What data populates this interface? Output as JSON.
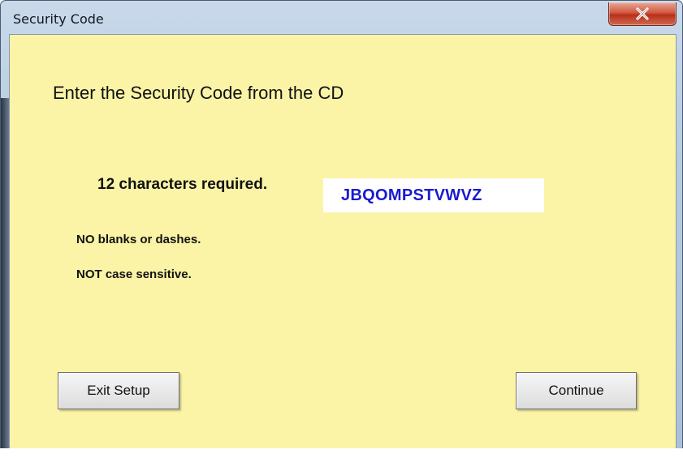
{
  "window": {
    "title": "Security Code",
    "close_icon": "close-icon"
  },
  "dialog": {
    "heading": "Enter the Security Code from the CD",
    "requirement_label": "12 characters required.",
    "code_value": "JBQOMPSTVWVZ",
    "hint_no_blanks": "NO blanks or dashes.",
    "hint_case": "NOT case sensitive."
  },
  "buttons": {
    "exit_label": "Exit Setup",
    "continue_label": "Continue"
  },
  "colors": {
    "client_background": "#fbf4a7",
    "code_text": "#1a1ad0",
    "close_button": "#c8402a"
  }
}
